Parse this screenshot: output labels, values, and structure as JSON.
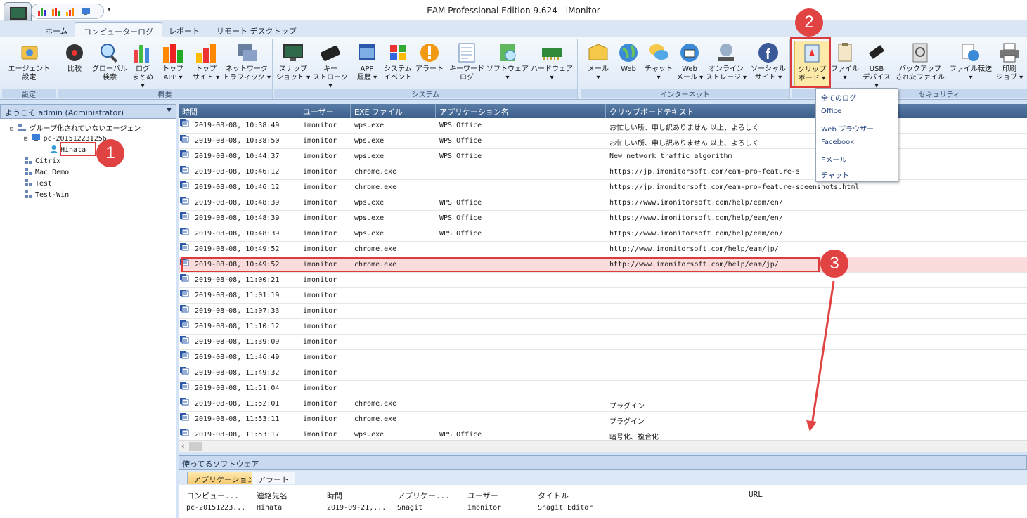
{
  "window": {
    "title": "EAM Professional Edition 9.624 - iMonitor"
  },
  "tabs": [
    "ホーム",
    "コンピューターログ",
    "レポート",
    "リモート デスクトップ"
  ],
  "ribbon": {
    "groups": [
      {
        "label": "設定",
        "buttons": [
          {
            "label": "エージェント\n設定",
            "icon": "agent-settings-icon"
          }
        ]
      },
      {
        "label": "概要",
        "buttons": [
          {
            "label": "比較",
            "icon": "compare-icon"
          },
          {
            "label": "グローバル\n検索",
            "icon": "global-search-icon"
          },
          {
            "label": "ログ\nまとめ ▾",
            "icon": "log-summary-icon"
          },
          {
            "label": "トップ\nAPP ▾",
            "icon": "top-app-icon"
          },
          {
            "label": "トップ\nサイト ▾",
            "icon": "top-site-icon"
          },
          {
            "label": "ネットワーク\nトラフィック ▾",
            "icon": "network-traffic-icon"
          }
        ]
      },
      {
        "label": "システム",
        "buttons": [
          {
            "label": "スナップ\nショット ▾",
            "icon": "snapshot-icon"
          },
          {
            "label": "キー\nストローク ▾",
            "icon": "keystroke-icon"
          },
          {
            "label": "APP\n履歴 ▾",
            "icon": "app-history-icon"
          },
          {
            "label": "システム\nイベント",
            "icon": "system-event-icon"
          },
          {
            "label": "アラート",
            "icon": "alert-icon"
          },
          {
            "label": "キーワード\nログ",
            "icon": "keyword-log-icon"
          },
          {
            "label": "ソフトウェア\n▾",
            "icon": "software-icon"
          },
          {
            "label": "ハードウェア\n▾",
            "icon": "hardware-icon"
          }
        ]
      },
      {
        "label": "インターネット",
        "buttons": [
          {
            "label": "メール\n▾",
            "icon": "mail-icon"
          },
          {
            "label": "Web",
            "icon": "web-icon"
          },
          {
            "label": "チャット\n▾",
            "icon": "chat-icon"
          },
          {
            "label": "Web\nメール ▾",
            "icon": "webmail-icon"
          },
          {
            "label": "オンライン\nストレージ ▾",
            "icon": "online-storage-icon"
          },
          {
            "label": "ソーシャル\nサイト ▾",
            "icon": "facebook-icon"
          }
        ]
      },
      {
        "label": "セキュリティ",
        "buttons": [
          {
            "label": "クリップ\nボード ▾",
            "icon": "clipboard-icon"
          },
          {
            "label": "ファイル\n▾",
            "icon": "file-icon"
          },
          {
            "label": "USB\nデバイス ▾",
            "icon": "usb-icon"
          },
          {
            "label": "バックアップ\nされたファイル",
            "icon": "backup-icon"
          },
          {
            "label": "ファイル転送\n▾",
            "icon": "file-transfer-icon"
          },
          {
            "label": "印刷\nジョブ ▾",
            "icon": "print-icon"
          }
        ]
      }
    ]
  },
  "left": {
    "header": "ようこそ admin (Administrator)",
    "tree": [
      {
        "label": "グループ化されていないエージェン"
      },
      {
        "label": "pc-201512231256"
      },
      {
        "label": "Hinata"
      },
      {
        "label": "Citrix"
      },
      {
        "label": "Mac Demo"
      },
      {
        "label": "Test"
      },
      {
        "label": "Test-Win"
      }
    ]
  },
  "grid": {
    "columns": [
      "時間",
      "ユーザー",
      "EXE ファイル",
      "アプリケーション名",
      "クリップボードテキスト"
    ],
    "rows": [
      [
        "2019-08-08, 10:38:49",
        "imonitor",
        "wps.exe",
        "WPS Office",
        "お忙しい所、申し訳ありません 以上、よろしく"
      ],
      [
        "2019-08-08, 10:38:50",
        "imonitor",
        "wps.exe",
        "WPS Office",
        "お忙しい所、申し訳ありません 以上、よろしく"
      ],
      [
        "2019-08-08, 10:44:37",
        "imonitor",
        "wps.exe",
        "WPS Office",
        "New network traffic algorithm"
      ],
      [
        "2019-08-08, 10:46:12",
        "imonitor",
        "chrome.exe",
        "",
        "https://jp.imonitorsoft.com/eam-pro-feature-s"
      ],
      [
        "2019-08-08, 10:46:12",
        "imonitor",
        "chrome.exe",
        "",
        "https://jp.imonitorsoft.com/eam-pro-feature-sceenshots.html"
      ],
      [
        "2019-08-08, 10:48:39",
        "imonitor",
        "wps.exe",
        "WPS Office",
        "https://www.imonitorsoft.com/help/eam/en/"
      ],
      [
        "2019-08-08, 10:48:39",
        "imonitor",
        "wps.exe",
        "WPS Office",
        "https://www.imonitorsoft.com/help/eam/en/"
      ],
      [
        "2019-08-08, 10:48:39",
        "imonitor",
        "wps.exe",
        "WPS Office",
        "https://www.imonitorsoft.com/help/eam/en/"
      ],
      [
        "2019-08-08, 10:49:52",
        "imonitor",
        "chrome.exe",
        "",
        "http://www.imonitorsoft.com/help/eam/jp/"
      ],
      [
        "2019-08-08, 10:49:52",
        "imonitor",
        "chrome.exe",
        "",
        "http://www.imonitorsoft.com/help/eam/jp/"
      ],
      [
        "2019-08-08, 11:00:21",
        "imonitor",
        "",
        "",
        ""
      ],
      [
        "2019-08-08, 11:01:19",
        "imonitor",
        "",
        "",
        ""
      ],
      [
        "2019-08-08, 11:07:33",
        "imonitor",
        "",
        "",
        ""
      ],
      [
        "2019-08-08, 11:10:12",
        "imonitor",
        "",
        "",
        ""
      ],
      [
        "2019-08-08, 11:39:09",
        "imonitor",
        "",
        "",
        ""
      ],
      [
        "2019-08-08, 11:46:49",
        "imonitor",
        "",
        "",
        ""
      ],
      [
        "2019-08-08, 11:49:32",
        "imonitor",
        "",
        "",
        ""
      ],
      [
        "2019-08-08, 11:51:04",
        "imonitor",
        "",
        "",
        ""
      ],
      [
        "2019-08-08, 11:52:01",
        "imonitor",
        "chrome.exe",
        "",
        "プラグイン"
      ],
      [
        "2019-08-08, 11:53:11",
        "imonitor",
        "chrome.exe",
        "",
        "プラグイン"
      ],
      [
        "2019-08-08, 11:53:17",
        "imonitor",
        "wps.exe",
        "WPS Office",
        "暗号化、複合化"
      ]
    ]
  },
  "dropdown": {
    "items": [
      "全てのログ",
      "Office",
      "Web ブラウザー",
      "Facebook",
      "Eメール",
      "チャット"
    ]
  },
  "bottom": {
    "header": "使ってるソフトウェア",
    "tabs": [
      "アプリケーション",
      "アラート"
    ],
    "columns": [
      "コンピュー...",
      "連絡先名",
      "時間",
      "アプリケー...",
      "ユーザー",
      "タイトル",
      "URL"
    ],
    "row": [
      "pc-20151223...",
      "Hinata",
      "2019-09-21,...",
      "Snagit",
      "imonitor",
      "Snagit Editor",
      ""
    ]
  },
  "annotations": {
    "badges": [
      "1",
      "2",
      "3"
    ],
    "color": "#e14343"
  },
  "colors": {
    "header_blue": "#3d5f8b",
    "selected_row": "#fbdcdc",
    "ribbon_bg": "#dce8f6"
  }
}
